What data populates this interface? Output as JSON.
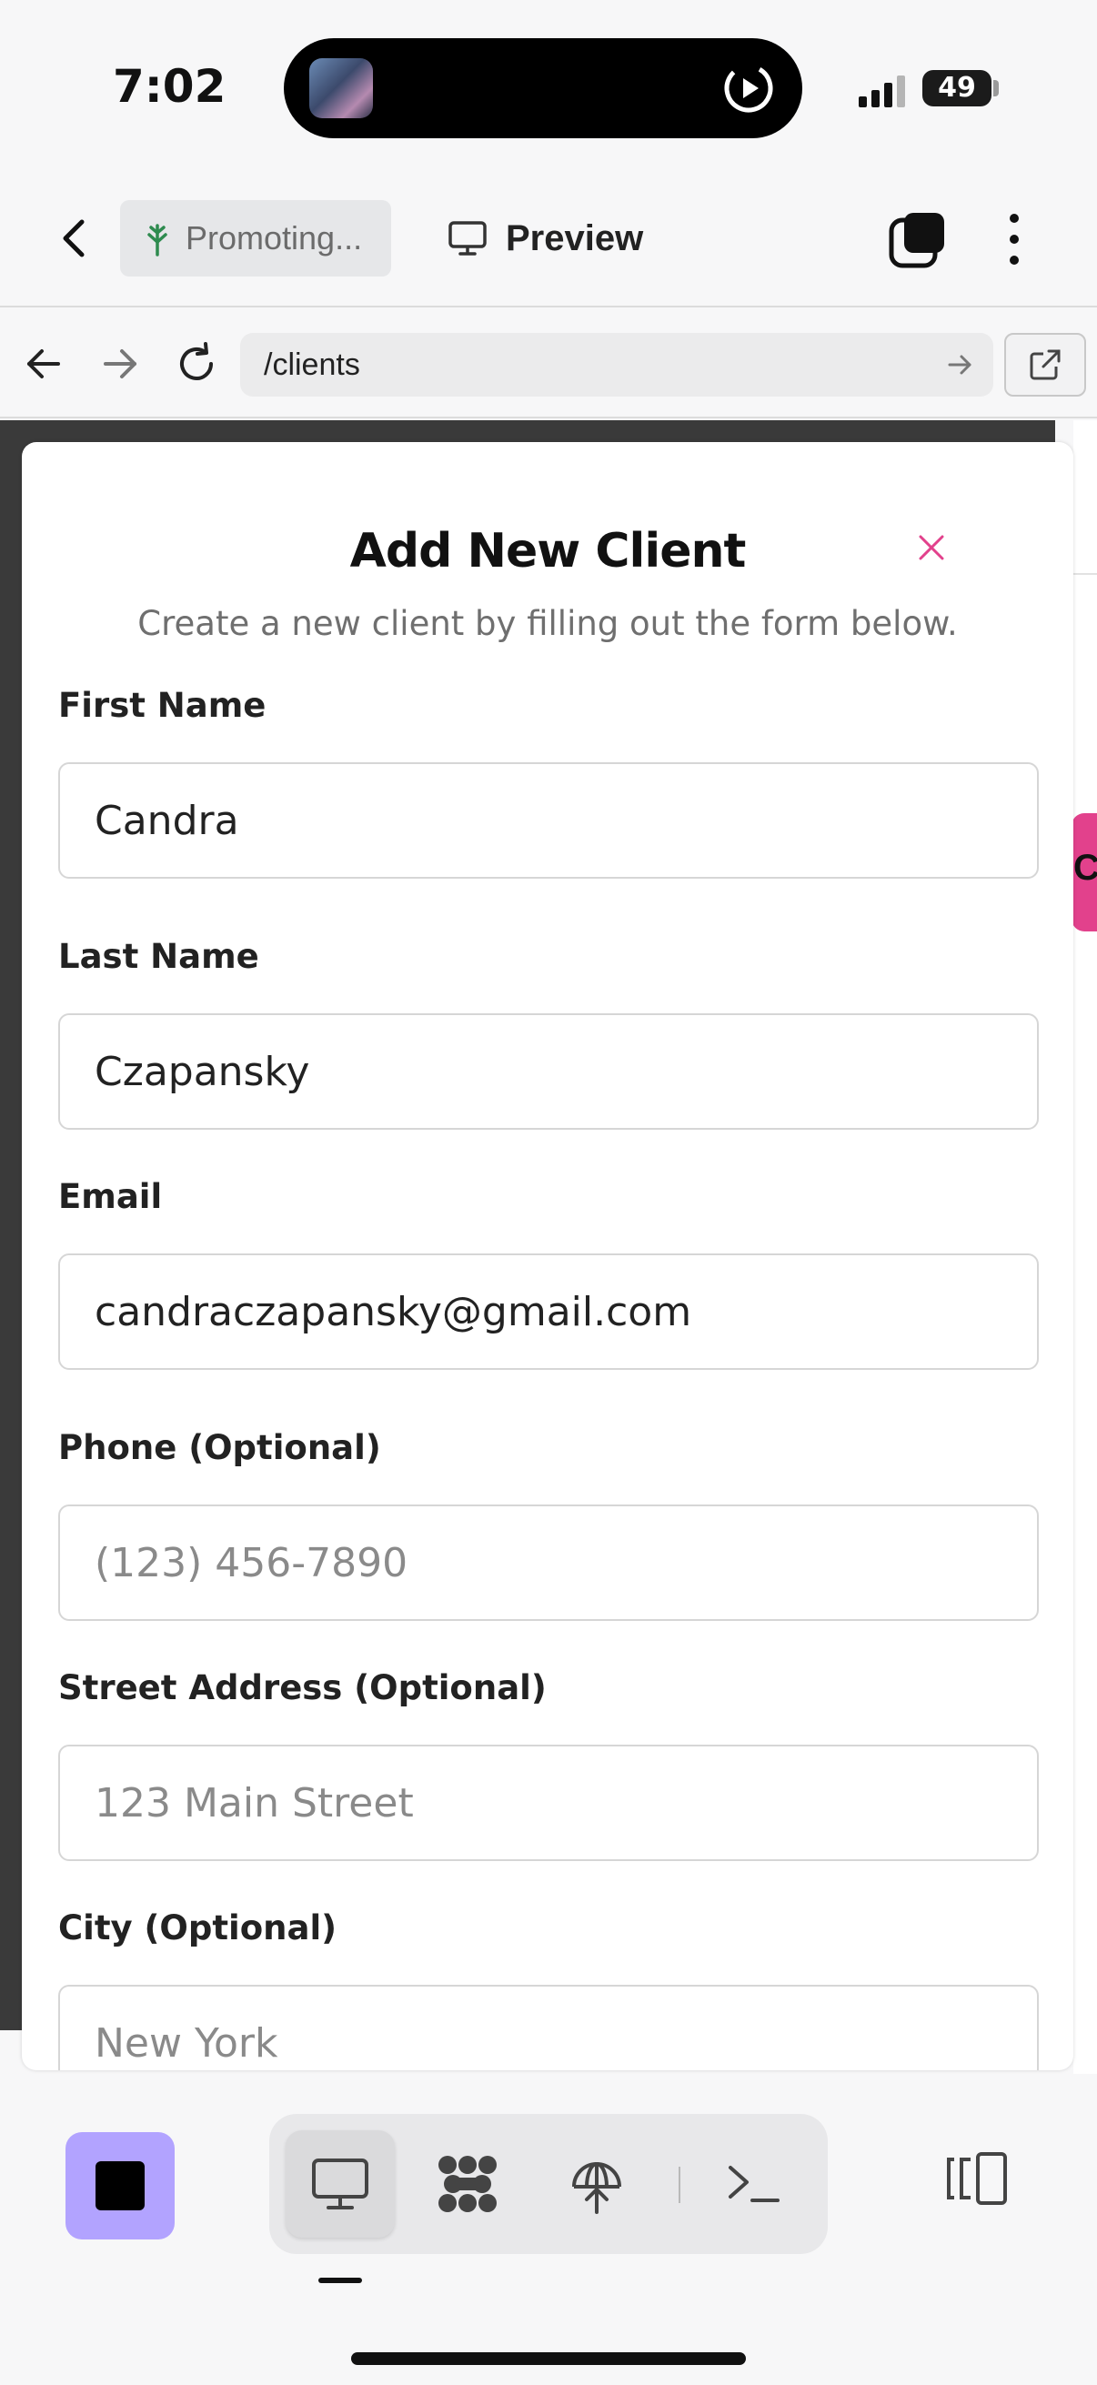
{
  "status_bar": {
    "time": "7:02",
    "battery": "49",
    "icons": [
      "screen-recording-thumbnail",
      "screen-record-play-icon",
      "cellular-signal-icon",
      "battery-icon"
    ]
  },
  "app_header": {
    "back_icon": "chevron-left-icon",
    "project_label": "Promoting...",
    "project_icon": "tree-icon",
    "preview_label": "Preview",
    "preview_icon": "monitor-icon",
    "tabs_icon": "stacked-squares-icon",
    "more_icon": "more-vertical-icon"
  },
  "browser_bar": {
    "url": "/clients",
    "icons": [
      "arrow-left-icon",
      "arrow-right-icon",
      "reload-icon",
      "arrow-right-small-icon",
      "external-link-icon"
    ]
  },
  "background_page": {
    "partial_button_text": "Cl",
    "accent_color": "#e2418c"
  },
  "modal": {
    "title": "Add New Client",
    "subtitle": "Create a new client by filling out the form below.",
    "close_icon_color": "#e2418c",
    "fields": [
      {
        "label": "First Name",
        "value": "Candra",
        "placeholder": ""
      },
      {
        "label": "Last Name",
        "value": "Czapansky",
        "placeholder": ""
      },
      {
        "label": "Email",
        "value": "candraczapansky@gmail.com",
        "placeholder": ""
      },
      {
        "label": "Phone (Optional)",
        "value": "",
        "placeholder": "(123) 456-7890"
      },
      {
        "label": "Street Address (Optional)",
        "value": "",
        "placeholder": "123 Main Street"
      },
      {
        "label": "City (Optional)",
        "value": "",
        "placeholder": "New York"
      }
    ]
  },
  "bottom_bar": {
    "stop_button_color": "#b2a3ff",
    "tools": [
      "desktop-preview-icon",
      "workflow-icon",
      "deploy-icon",
      "terminal-icon"
    ],
    "active_tool": "desktop-preview-icon",
    "panel_icon": "panel-toggle-icon"
  }
}
